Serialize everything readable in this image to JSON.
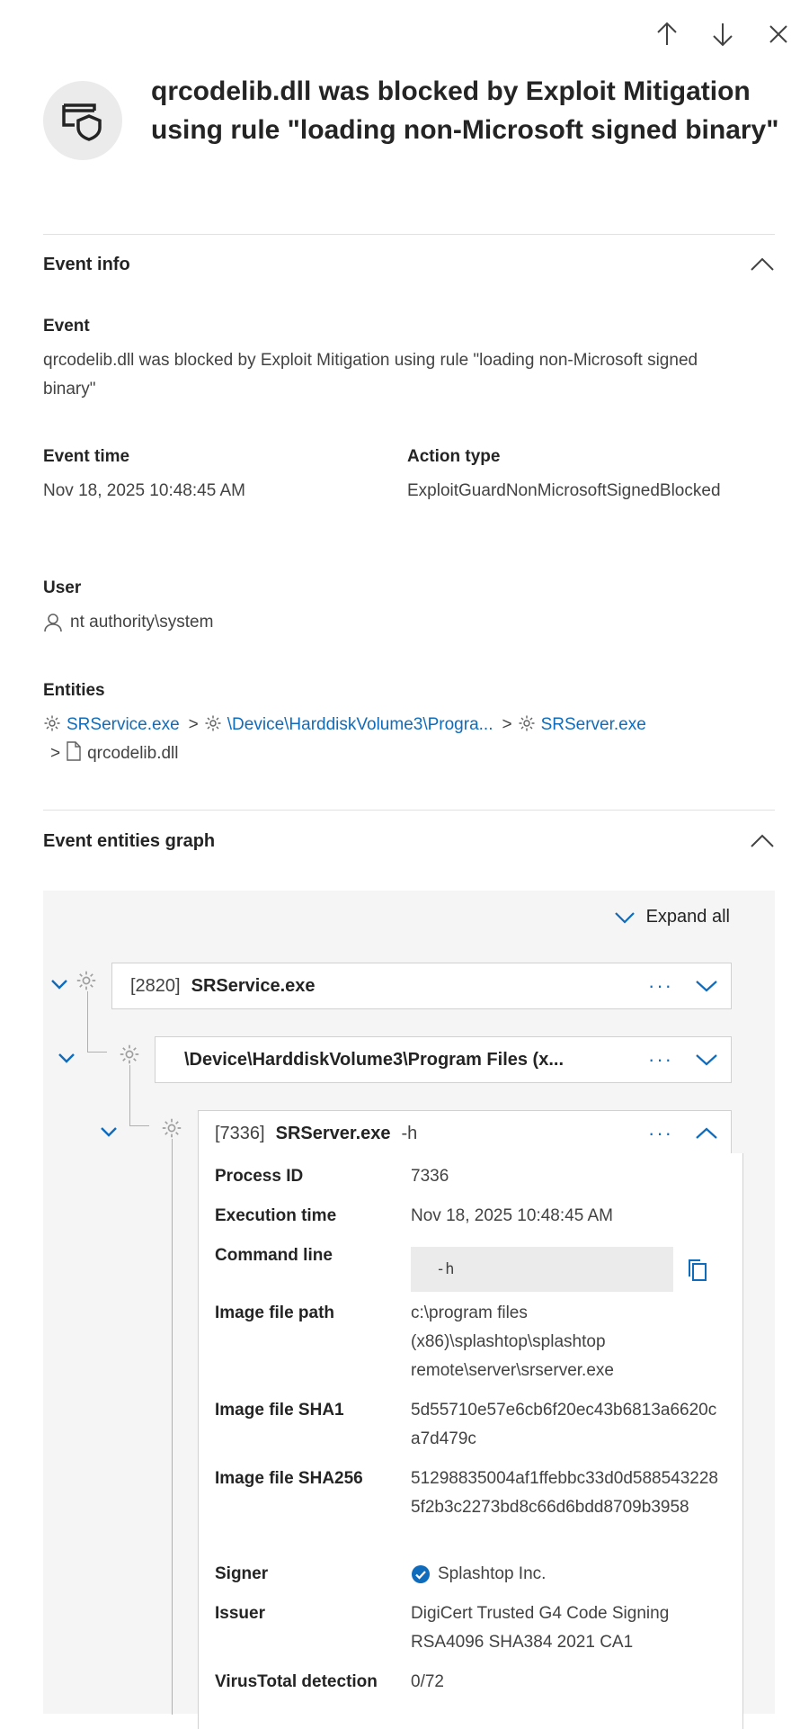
{
  "title": "qrcodelib.dll was blocked by Exploit Mitigation using rule \"loading non-Microsoft signed binary\"",
  "sections": {
    "event_info": "Event info",
    "graph": "Event entities graph"
  },
  "event": {
    "label": "Event",
    "value": "qrcodelib.dll was blocked by Exploit Mitigation using rule \"loading non-Microsoft signed binary\""
  },
  "event_time": {
    "label": "Event time",
    "value": "Nov 18, 2025 10:48:45 AM"
  },
  "action_type": {
    "label": "Action type",
    "value": "ExploitGuardNonMicrosoftSignedBlocked"
  },
  "user": {
    "label": "User",
    "value": "nt authority\\system"
  },
  "entities": {
    "label": "Entities",
    "items": [
      "SRService.exe",
      "\\Device\\HarddiskVolume3\\Progra...",
      "SRServer.exe",
      "qrcodelib.dll"
    ],
    "separator": ">"
  },
  "graph": {
    "expand_all": "Expand all",
    "more": "···",
    "nodes": [
      {
        "pid": "[2820]",
        "name": "SRService.exe",
        "args": ""
      },
      {
        "pid": "",
        "name": "\\Device\\HarddiskVolume3\\Program Files (x...",
        "args": ""
      },
      {
        "pid": "[7336]",
        "name": "SRServer.exe",
        "args": "-h"
      }
    ],
    "details": {
      "process_id": {
        "label": "Process ID",
        "value": "7336"
      },
      "execution_time": {
        "label": "Execution time",
        "value": "Nov 18, 2025 10:48:45 AM"
      },
      "command_line": {
        "label": "Command line",
        "value": "-h"
      },
      "image_path": {
        "label": "Image file path",
        "value": "c:\\program files (x86)\\splashtop\\splashtop remote\\server\\srserver.exe"
      },
      "sha1": {
        "label": "Image file SHA1",
        "value": "5d55710e57e6cb6f20ec43b6813a6620ca7d479c"
      },
      "sha256": {
        "label": "Image file SHA256",
        "value": "51298835004af1ffebbc33d0d5885432285f2b3c2273bd8c66d6bdd8709b3958"
      },
      "signer": {
        "label": "Signer",
        "value": "Splashtop Inc."
      },
      "issuer": {
        "label": "Issuer",
        "value": "DigiCert Trusted G4 Code Signing RSA4096 SHA384 2021 CA1"
      },
      "virustotal": {
        "label": "VirusTotal detection",
        "value": "0/72"
      }
    }
  },
  "colors": {
    "link": "#0f6cbd",
    "verified": "#0f6cbd",
    "graph_bg": "#f5f5f5"
  }
}
